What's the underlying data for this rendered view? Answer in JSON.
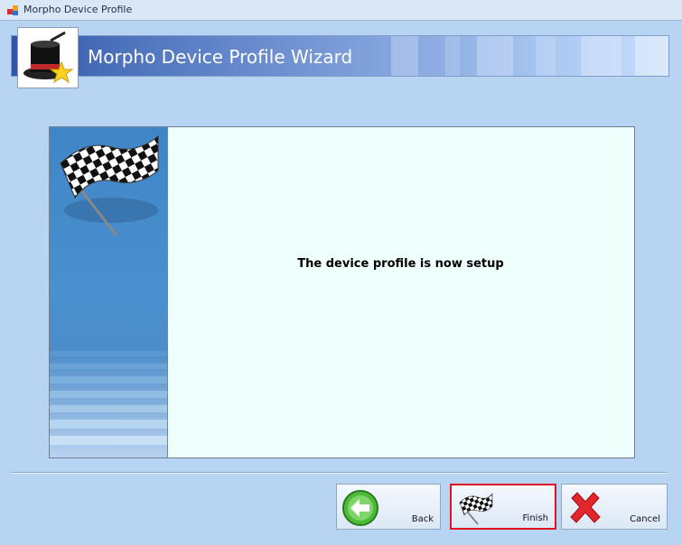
{
  "window": {
    "title": "Morpho Device Profile"
  },
  "wizard": {
    "header_title": "Morpho Device Profile Wizard",
    "message": "The device profile is now setup"
  },
  "buttons": {
    "back": "Back",
    "finish": "Finish",
    "cancel": "Cancel"
  },
  "colors": {
    "banner": "#4f74bd",
    "panel_bg": "#effffb",
    "finish_border": "#e0141e"
  }
}
